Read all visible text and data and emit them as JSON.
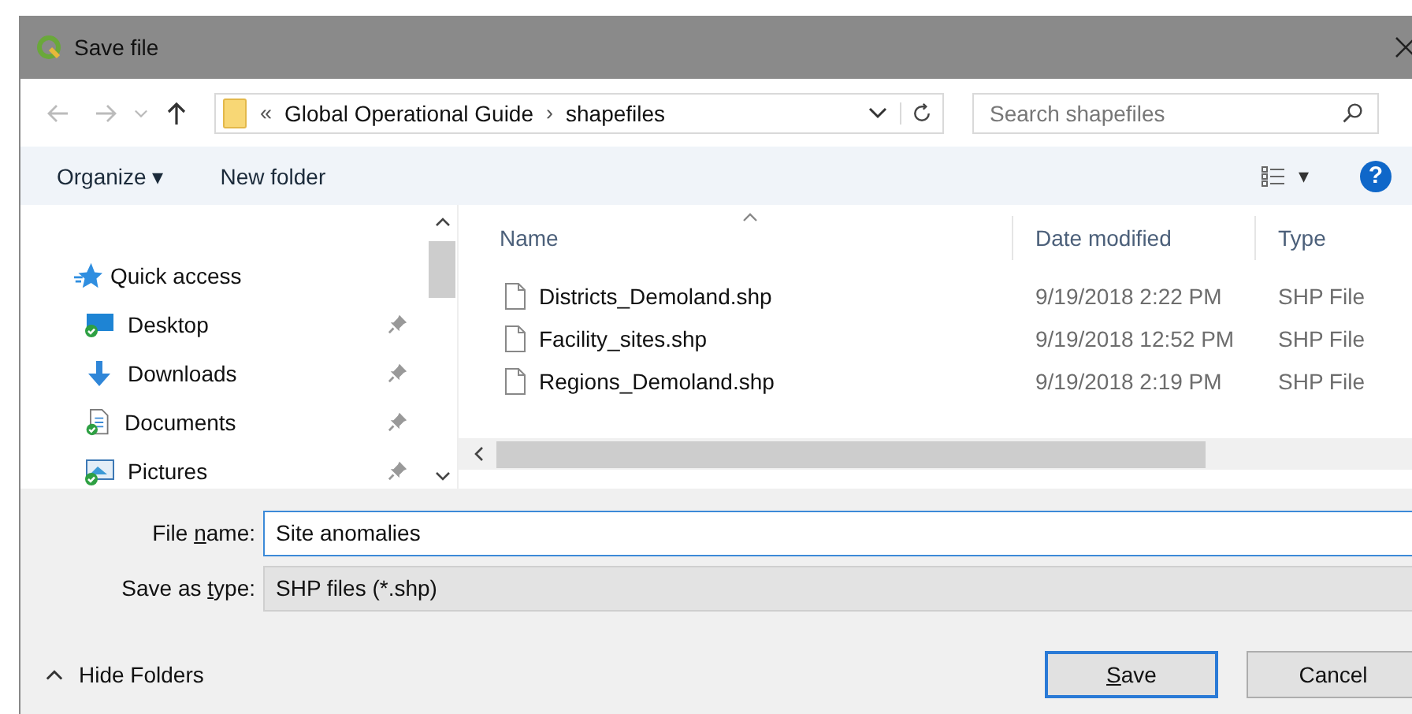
{
  "window": {
    "title": "Save file"
  },
  "address": {
    "overflow": "«",
    "path": [
      "Global Operational Guide",
      "shapefiles"
    ],
    "separator": "›"
  },
  "search": {
    "placeholder": "Search shapefiles"
  },
  "toolbar": {
    "organize": "Organize ▾",
    "new_folder": "New folder",
    "view_caret": "▾",
    "help": "?"
  },
  "sidebar": {
    "items": [
      {
        "label": "Quick access",
        "kind": "quick",
        "pinned": false
      },
      {
        "label": "Desktop",
        "kind": "desktop",
        "pinned": true
      },
      {
        "label": "Downloads",
        "kind": "downloads",
        "pinned": true
      },
      {
        "label": "Documents",
        "kind": "documents",
        "pinned": true
      },
      {
        "label": "Pictures",
        "kind": "pictures",
        "pinned": true
      }
    ]
  },
  "table": {
    "columns": [
      "Name",
      "Date modified",
      "Type"
    ],
    "rows": [
      {
        "name": "Districts_Demoland.shp",
        "date": "9/19/2018 2:22 PM",
        "type": "SHP File"
      },
      {
        "name": "Facility_sites.shp",
        "date": "9/19/2018 12:52 PM",
        "type": "SHP File"
      },
      {
        "name": "Regions_Demoland.shp",
        "date": "9/19/2018 2:19 PM",
        "type": "SHP File"
      }
    ]
  },
  "form": {
    "fields": [
      {
        "label_parts": [
          "File ",
          "n",
          "ame:"
        ],
        "value": "Site anomalies",
        "kind": "input"
      },
      {
        "label_parts": [
          "Save as ",
          "t",
          "ype:"
        ],
        "value": "SHP files (*.shp)",
        "kind": "select"
      }
    ]
  },
  "hide_folders": "Hide Folders",
  "buttons": [
    {
      "access_key": "S",
      "rest": "ave",
      "default": true
    },
    {
      "label": "Cancel",
      "default": false
    }
  ]
}
